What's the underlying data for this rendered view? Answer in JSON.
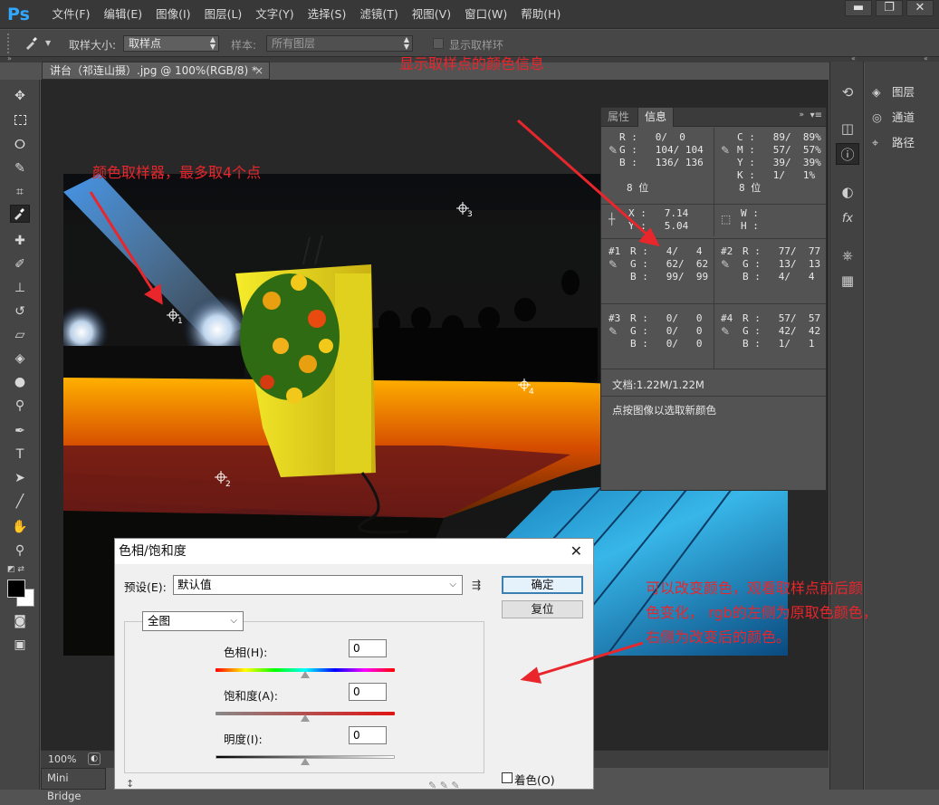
{
  "app": {
    "logo": "Ps",
    "menu": [
      "文件(F)",
      "编辑(E)",
      "图像(I)",
      "图层(L)",
      "文字(Y)",
      "选择(S)",
      "滤镜(T)",
      "视图(V)",
      "窗口(W)",
      "帮助(H)"
    ],
    "window_buttons": [
      "▬",
      "❐",
      "✕"
    ]
  },
  "options": {
    "sample_size_label": "取样大小:",
    "sample_size_value": "取样点",
    "sample_label": "样本:",
    "sample_value": "所有图层",
    "show_ring_label": "显示取样环"
  },
  "document": {
    "tab_title": "讲台（祁连山摄）.jpg @ 100%(RGB/8) *",
    "close": "×",
    "zoom": "100%"
  },
  "minibridge": "Mini Bridge",
  "layers_panel": {
    "items": [
      "图层",
      "通道",
      "路径"
    ]
  },
  "info_panel": {
    "tabs": [
      "属性",
      "信息"
    ],
    "rgb": {
      "R": "0/  0",
      "G": "104/ 104",
      "B": "136/ 136"
    },
    "cmyk": {
      "C": "89/  89%",
      "M": "57/  57%",
      "Y": "39/  39%",
      "K": "1/   1%"
    },
    "bits_left": "8 位",
    "bits_right": "8 位",
    "xy": {
      "X": "7.14",
      "Y": "5.04"
    },
    "wh": {
      "W": "",
      "H": ""
    },
    "samplers": [
      {
        "id": "#1",
        "R": "4/   4",
        "G": "62/  62",
        "B": "99/  99"
      },
      {
        "id": "#2",
        "R": "77/  77",
        "G": "13/  13",
        "B": "4/   4"
      },
      {
        "id": "#3",
        "R": "0/   0",
        "G": "0/   0",
        "B": "0/   0"
      },
      {
        "id": "#4",
        "R": "57/  57",
        "G": "42/  42",
        "B": "1/   1"
      }
    ],
    "doc_size": "文档:1.22M/1.22M",
    "hint": "点按图像以选取新颜色"
  },
  "dialog": {
    "title": "色相/饱和度",
    "preset_label": "预设(E):",
    "preset_value": "默认值",
    "channel_value": "全图",
    "ok": "确定",
    "reset": "复位",
    "hue_label": "色相(H):",
    "hue_value": "0",
    "sat_label": "饱和度(A):",
    "sat_value": "0",
    "light_label": "明度(I):",
    "light_value": "0",
    "colorize_label": "着色(O)"
  },
  "annotations": {
    "samplers_note": "颜色取样器，最多取4个点",
    "info_note": "显示取样点的颜色信息",
    "change_note_1": "可以改变颜色，观看取样点前后颜",
    "change_note_2": "色变化， rgb的左侧为原取色颜色，",
    "change_note_3": "右侧为改变后的颜色。"
  },
  "sampler_markers": [
    "1",
    "2",
    "3",
    "4"
  ],
  "colors": {
    "accent_red": "#e8262c",
    "ps_blue": "#31a8ff"
  }
}
